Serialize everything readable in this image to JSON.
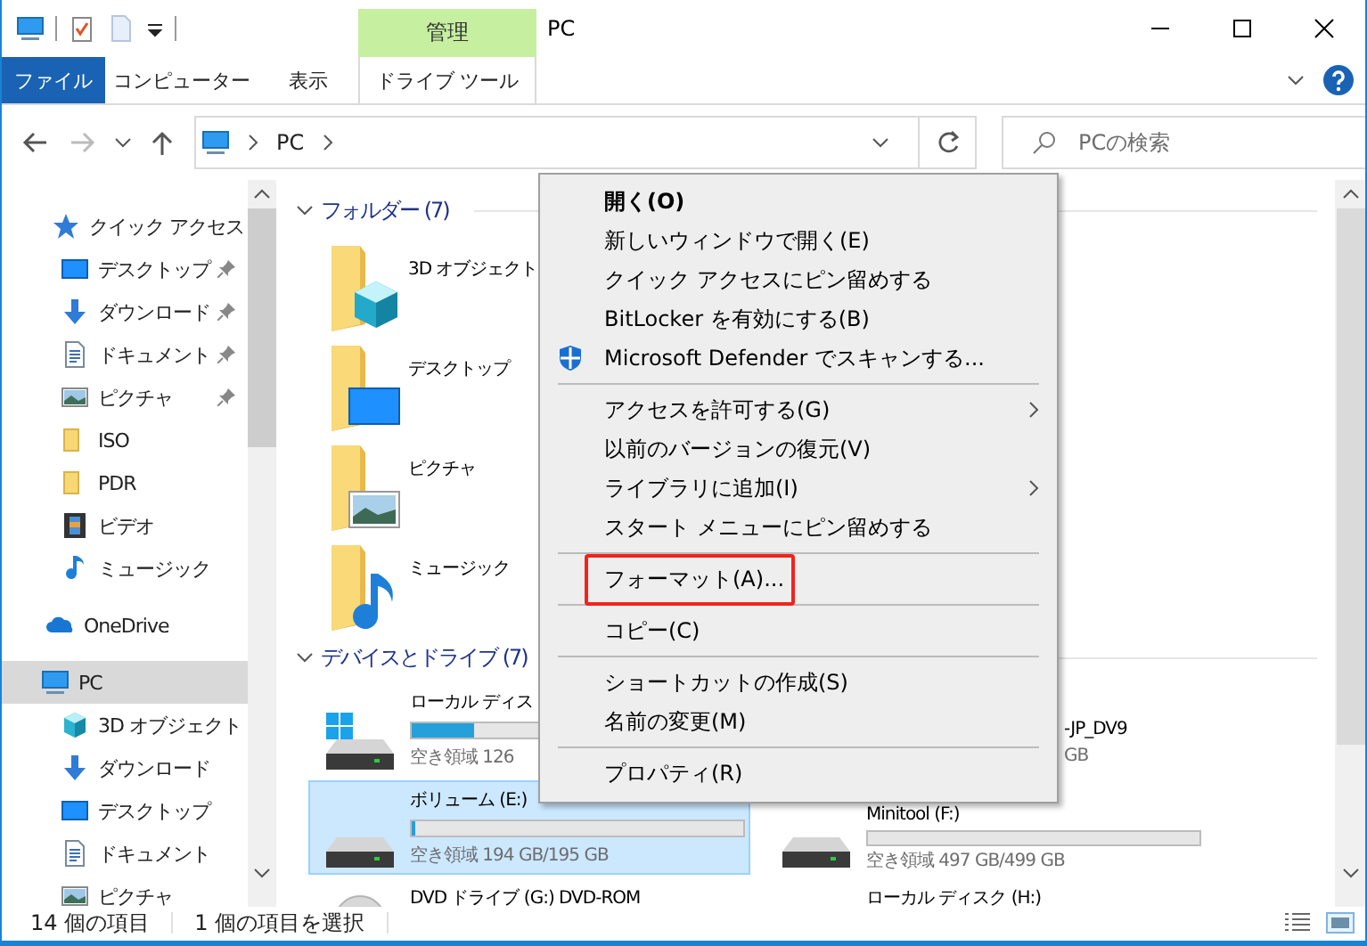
{
  "title_bar": {
    "context_group": "管理",
    "title": "PC"
  },
  "ribbon_tabs": [
    {
      "label": "ファイル",
      "kind": "file"
    },
    {
      "label": "コンピューター",
      "kind": "plain"
    },
    {
      "label": "表示",
      "kind": "plain"
    },
    {
      "label": "ドライブ ツール",
      "kind": "contextual"
    }
  ],
  "address_bar": {
    "path": [
      "PC"
    ]
  },
  "search": {
    "placeholder": "PCの検索"
  },
  "navigation": [
    {
      "label": "クイック アクセス",
      "kind": "star",
      "selected": false,
      "children": [
        {
          "label": "デスクトップ",
          "kind": "desktop",
          "pinned": true,
          "selected": false
        },
        {
          "label": "ダウンロード",
          "kind": "download",
          "pinned": true,
          "selected": false
        },
        {
          "label": "ドキュメント",
          "kind": "document",
          "pinned": true,
          "selected": false
        },
        {
          "label": "ピクチャ",
          "kind": "picture",
          "pinned": true,
          "selected": false
        },
        {
          "label": "ISO",
          "kind": "folder",
          "pinned": false,
          "selected": false
        },
        {
          "label": "PDR",
          "kind": "folder",
          "pinned": false,
          "selected": false
        },
        {
          "label": "ビデオ",
          "kind": "video",
          "pinned": false,
          "selected": false
        },
        {
          "label": "ミュージック",
          "kind": "music",
          "pinned": false,
          "selected": false
        }
      ]
    },
    {
      "label": "OneDrive",
      "kind": "cloud",
      "selected": false
    },
    {
      "label": "PC",
      "kind": "pc",
      "selected": true,
      "children": [
        {
          "label": "3D オブジェクト",
          "kind": "objects3d",
          "pinned": false,
          "selected": false
        },
        {
          "label": "ダウンロード",
          "kind": "download",
          "pinned": false,
          "selected": false
        },
        {
          "label": "デスクトップ",
          "kind": "desktop",
          "pinned": false,
          "selected": false
        },
        {
          "label": "ドキュメント",
          "kind": "document",
          "pinned": false,
          "selected": false
        },
        {
          "label": "ピクチャ",
          "kind": "picture",
          "pinned": false,
          "selected": false
        }
      ]
    }
  ],
  "folders": {
    "heading": "フォルダー (7)",
    "expanded": true,
    "items": [
      {
        "name": "3D オブジェクト",
        "kind": "objects3d"
      },
      {
        "name": "デスクトップ",
        "kind": "desktop"
      },
      {
        "name": "ピクチャ",
        "kind": "picture"
      },
      {
        "name": "ミュージック",
        "kind": "music"
      }
    ]
  },
  "drives": {
    "heading": "デバイスとドライブ (7)",
    "expanded": true,
    "items": [
      {
        "name": "ローカル ディス",
        "kind": "system",
        "level": 0.19,
        "free": "空き領域 126",
        "selected": false
      },
      {
        "name": "-JP_DV9",
        "kind": "covered",
        "free": "GB",
        "selected": false
      },
      {
        "name": "ボリューム (E:)",
        "kind": "disk",
        "level": 0.01,
        "free": "空き領域 194 GB/195 GB",
        "selected": true
      },
      {
        "name": "Minitool (F:)",
        "kind": "disk",
        "level": 0,
        "free": "空き領域 497 GB/499 GB",
        "selected": false
      },
      {
        "name": "DVD ドライブ (G:) DVD-ROM",
        "kind": "dvd",
        "selected": false
      },
      {
        "name": "ローカル ディスク (H:)",
        "kind": "offscreen",
        "selected": false
      }
    ]
  },
  "context_menu": [
    {
      "kind": "command",
      "label": "開く(O)",
      "default": true,
      "submenu": false,
      "highlighted": false
    },
    {
      "kind": "command",
      "label": "新しいウィンドウで開く(E)",
      "default": false,
      "submenu": false,
      "highlighted": false
    },
    {
      "kind": "command",
      "label": "クイック アクセスにピン留めする",
      "default": false,
      "submenu": false,
      "highlighted": false
    },
    {
      "kind": "command",
      "label": "BitLocker を有効にする(B)",
      "default": false,
      "submenu": false,
      "highlighted": false
    },
    {
      "kind": "scan",
      "label": "Microsoft Defender でスキャンする...",
      "default": false,
      "submenu": false,
      "highlighted": false
    },
    {
      "kind": "separator"
    },
    {
      "kind": "command",
      "label": "アクセスを許可する(G)",
      "default": false,
      "submenu": true,
      "highlighted": false
    },
    {
      "kind": "command",
      "label": "以前のバージョンの復元(V)",
      "default": false,
      "submenu": false,
      "highlighted": false
    },
    {
      "kind": "command",
      "label": "ライブラリに追加(I)",
      "default": false,
      "submenu": true,
      "highlighted": false
    },
    {
      "kind": "command",
      "label": "スタート メニューにピン留めする",
      "default": false,
      "submenu": false,
      "highlighted": false
    },
    {
      "kind": "separator"
    },
    {
      "kind": "command",
      "label": "フォーマット(A)...",
      "default": false,
      "submenu": false,
      "highlighted": true
    },
    {
      "kind": "separator"
    },
    {
      "kind": "command",
      "label": "コピー(C)",
      "default": false,
      "submenu": false,
      "highlighted": false
    },
    {
      "kind": "separator"
    },
    {
      "kind": "command",
      "label": "ショートカットの作成(S)",
      "default": false,
      "submenu": false,
      "highlighted": false
    },
    {
      "kind": "command",
      "label": "名前の変更(M)",
      "default": false,
      "submenu": false,
      "highlighted": false
    },
    {
      "kind": "separator"
    },
    {
      "kind": "command",
      "label": "プロパティ(R)",
      "default": false,
      "submenu": false,
      "highlighted": false
    }
  ],
  "status_bar": {
    "item_count": "14 個の項目",
    "selection": "1 個の項目を選択"
  }
}
